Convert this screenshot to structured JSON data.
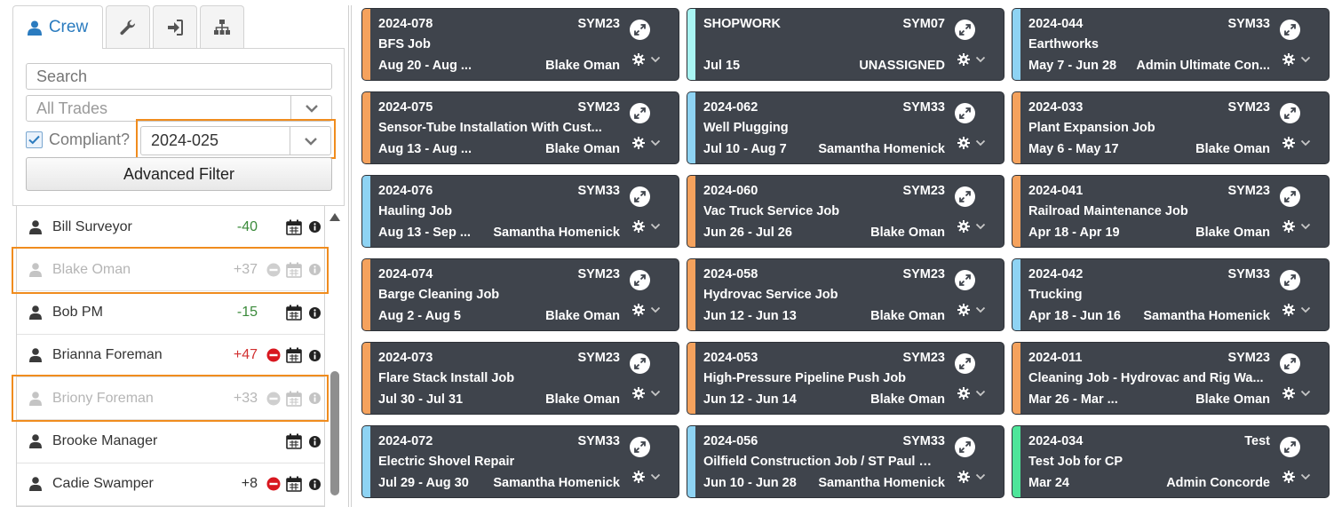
{
  "tabs": {
    "crew_label": "Crew",
    "icons": [
      "wrench-icon",
      "sign-in-icon",
      "sitemap-icon"
    ]
  },
  "filters": {
    "search_placeholder": "Search",
    "trades_value": "All Trades",
    "compliant_label": "Compliant?",
    "compliant_checked": true,
    "year_value": "2024-025",
    "advanced_filter_label": "Advanced Filter"
  },
  "crew": [
    {
      "name": "Bill Surveyor",
      "score": "-40",
      "score_color": "green",
      "minus": false,
      "dim": false
    },
    {
      "name": "Blake Oman",
      "score": "+37",
      "score_color": "dim",
      "minus": true,
      "dim": true
    },
    {
      "name": "Bob PM",
      "score": "-15",
      "score_color": "green",
      "minus": false,
      "dim": false
    },
    {
      "name": "Brianna Foreman",
      "score": "+47",
      "score_color": "red",
      "minus": true,
      "dim": false
    },
    {
      "name": "Briony Foreman",
      "score": "+33",
      "score_color": "dim",
      "minus": true,
      "dim": true
    },
    {
      "name": "Brooke Manager",
      "score": "",
      "score_color": "neutral",
      "minus": false,
      "dim": false
    },
    {
      "name": "Cadie Swamper",
      "score": "+8",
      "score_color": "neutral",
      "minus": true,
      "dim": false
    }
  ],
  "colors": {
    "orange": "#f5a25d",
    "blue": "#8ed3f3",
    "cyan": "#a9f5f3",
    "green": "#4ee59a",
    "card_bg": "#3f444c",
    "highlight": "#f08c1e"
  },
  "jobs": [
    {
      "id": "2024-078",
      "sym": "SYM23",
      "title": "BFS Job",
      "dates": "Aug 20 - Aug ...",
      "person": "Blake Oman",
      "color": "orange"
    },
    {
      "id": "SHOPWORK",
      "sym": "SYM07",
      "title": "",
      "dates": "Jul 15",
      "person": "UNASSIGNED",
      "color": "cyan"
    },
    {
      "id": "2024-044",
      "sym": "SYM33",
      "title": "Earthworks",
      "dates": "May 7 - Jun 28",
      "person": "Admin Ultimate Con...",
      "color": "blue"
    },
    {
      "id": "2024-075",
      "sym": "SYM23",
      "title": "Sensor-Tube Installation With Cust...",
      "dates": "Aug 13 - Aug ...",
      "person": "Blake Oman",
      "color": "orange"
    },
    {
      "id": "2024-062",
      "sym": "SYM33",
      "title": "Well Plugging",
      "dates": "Jul 10 - Aug 7",
      "person": "Samantha Homenick",
      "color": "blue"
    },
    {
      "id": "2024-033",
      "sym": "SYM23",
      "title": "Plant Expansion Job",
      "dates": "May 6 - May 17",
      "person": "Blake Oman",
      "color": "orange"
    },
    {
      "id": "2024-076",
      "sym": "SYM33",
      "title": "Hauling Job",
      "dates": "Aug 13 - Sep ...",
      "person": "Samantha Homenick",
      "color": "blue"
    },
    {
      "id": "2024-060",
      "sym": "SYM23",
      "title": "Vac Truck Service Job",
      "dates": "Jun 26 - Jul 26",
      "person": "Blake Oman",
      "color": "orange"
    },
    {
      "id": "2024-041",
      "sym": "SYM23",
      "title": "Railroad Maintenance Job",
      "dates": "Apr 18 - Apr 19",
      "person": "Blake Oman",
      "color": "orange"
    },
    {
      "id": "2024-074",
      "sym": "SYM23",
      "title": "Barge Cleaning Job",
      "dates": "Aug 2 - Aug 5",
      "person": "Blake Oman",
      "color": "orange"
    },
    {
      "id": "2024-058",
      "sym": "SYM23",
      "title": "Hydrovac Service Job",
      "dates": "Jun 12 - Jun 13",
      "person": "Blake Oman",
      "color": "orange"
    },
    {
      "id": "2024-042",
      "sym": "SYM33",
      "title": "Trucking",
      "dates": "Apr 18 - Jun 16",
      "person": "Samantha Homenick",
      "color": "blue"
    },
    {
      "id": "2024-073",
      "sym": "SYM23",
      "title": "Flare Stack Install Job",
      "dates": "Jul 30 - Jul 31",
      "person": "Blake Oman",
      "color": "orange"
    },
    {
      "id": "2024-053",
      "sym": "SYM23",
      "title": "High-Pressure Pipeline Push Job",
      "dates": "Jun 12 - Jun 14",
      "person": "Blake Oman",
      "color": "orange"
    },
    {
      "id": "2024-011",
      "sym": "SYM23",
      "title": "Cleaning Job - Hydrovac and Rig Wa...",
      "dates": "Mar 26 - Mar ...",
      "person": "Blake Oman",
      "color": "orange"
    },
    {
      "id": "2024-072",
      "sym": "SYM33",
      "title": "Electric Shovel Repair",
      "dates": "Jul 29 - Aug 30",
      "person": "Samantha Homenick",
      "color": "blue"
    },
    {
      "id": "2024-056",
      "sym": "SYM33",
      "title": "Oilfield Construction Job / ST Paul B...",
      "dates": "Jun 10 - Jun 28",
      "person": "Samantha Homenick",
      "color": "blue"
    },
    {
      "id": "2024-034",
      "sym": "Test",
      "title": "Test Job for CP",
      "dates": "Mar 24",
      "person": "Admin Concorde",
      "color": "green"
    }
  ]
}
